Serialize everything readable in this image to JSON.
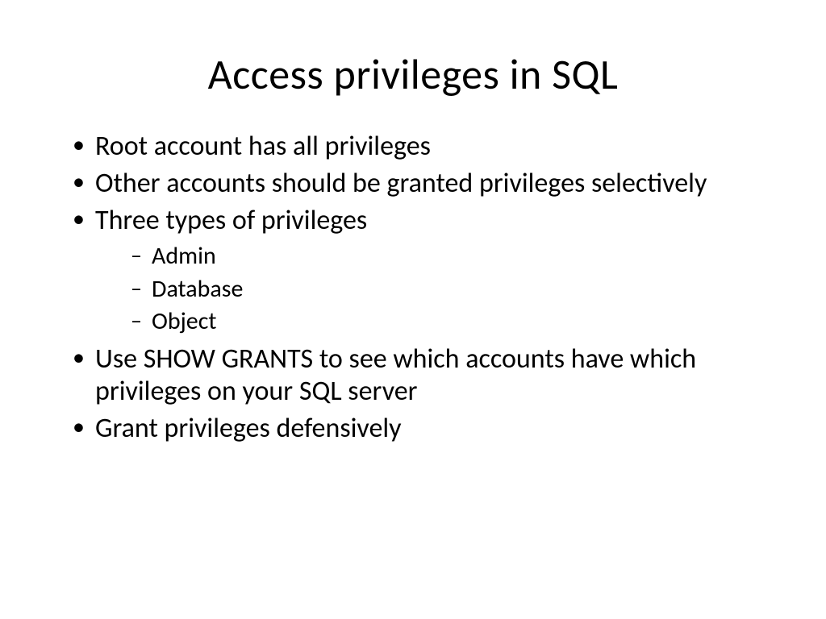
{
  "title": "Access privileges in SQL",
  "bullets": {
    "b0": "Root account has all privileges",
    "b1": "Other accounts should be granted privileges selectively",
    "b2": "Three types of privileges",
    "b2_sub": {
      "s0": "Admin",
      "s1": "Database",
      "s2": "Object"
    },
    "b3": "Use SHOW GRANTS to see which accounts have which privileges on your SQL server",
    "b4": "Grant privileges defensively"
  }
}
